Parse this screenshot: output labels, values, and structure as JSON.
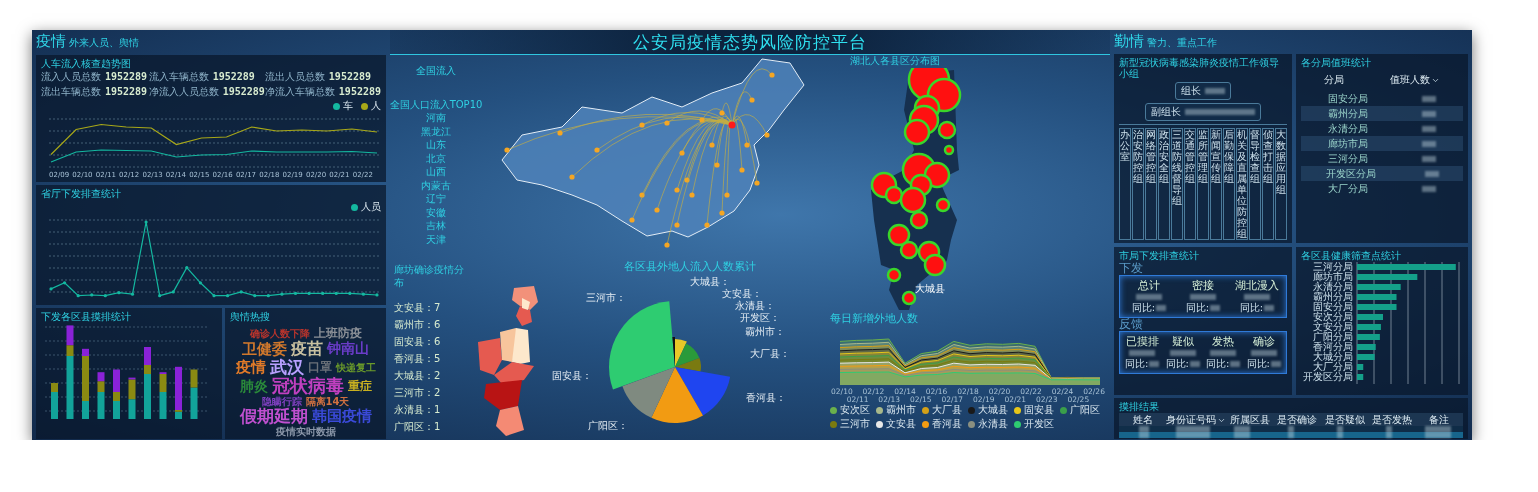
{
  "left": {
    "header": {
      "title": "疫情",
      "subtitle": "外来人员、舆情"
    },
    "flow_trend": {
      "title": "人车流入核查趋势图",
      "stats": [
        {
          "label": "流入人员总数",
          "value": "1952289"
        },
        {
          "label": "流入车辆总数",
          "value": "1952289"
        },
        {
          "label": "流出人员总数",
          "value": "1952289"
        },
        {
          "label": "流出车辆总数",
          "value": "1952289"
        },
        {
          "label": "净流入人员总数",
          "value": "1952289"
        },
        {
          "label": "净流入车辆总数",
          "value": "1952289"
        }
      ],
      "legend": [
        {
          "name": "车",
          "color": "#14b8a0"
        },
        {
          "name": "人",
          "color": "#a8a818"
        }
      ],
      "x_labels": [
        "02/09",
        "02/10",
        "02/11",
        "02/12",
        "02/13",
        "02/14",
        "02/15",
        "02/16",
        "02/17",
        "02/18",
        "02/19",
        "02/20",
        "02/21",
        "02/22"
      ]
    },
    "province_check": {
      "title": "省厅下发排查统计",
      "legend": [
        {
          "name": "人员",
          "color": "#14b8a0"
        }
      ]
    },
    "district_check": {
      "title": "下发各区县摸排统计"
    },
    "hot_search": {
      "title": "舆情热搜",
      "words": [
        {
          "text": "确诊人数下降",
          "color": "#b8342c"
        },
        {
          "text": "上班防疫",
          "color": "#8a8f96"
        },
        {
          "text": "卫健委",
          "color": "#d0782c"
        },
        {
          "text": "疫苗",
          "color": "#c8c0a0"
        },
        {
          "text": "钟南山",
          "color": "#6a3cc8"
        },
        {
          "text": "疫情",
          "color": "#e07a28"
        },
        {
          "text": "武汉",
          "color": "#b8a0ff"
        },
        {
          "text": "口罩",
          "color": "#6a7078"
        },
        {
          "text": "快递复工",
          "color": "#6a9a2a"
        },
        {
          "text": "肺炎",
          "color": "#2a8a3a"
        },
        {
          "text": "冠状病毒",
          "color": "#c040c0"
        },
        {
          "text": "重症",
          "color": "#c8b020"
        },
        {
          "text": "隐瞒行踪",
          "color": "#8040c0"
        },
        {
          "text": "隔离14天",
          "color": "#d07040"
        },
        {
          "text": "假期延期",
          "color": "#c050d0"
        },
        {
          "text": "韩国疫情",
          "color": "#3a4ad8"
        },
        {
          "text": "疫情实时数据",
          "color": "#8a96a8"
        }
      ]
    }
  },
  "center": {
    "title": "公安局疫情态势风险防控平台",
    "national_inflow": {
      "title": "全国流入",
      "top_title": "全国人口流入TOP10",
      "top": [
        "河南",
        "黑龙江",
        "山东",
        "北京",
        "山西",
        "内蒙古",
        "辽宁",
        "安徽",
        "吉林",
        "天津"
      ]
    },
    "langfang": {
      "title": "廊坊确诊疫情分布",
      "items": [
        {
          "name": "文安县：",
          "count": "7"
        },
        {
          "name": "霸州市：",
          "count": "6"
        },
        {
          "name": "固安县：",
          "count": "6"
        },
        {
          "name": "香河县：",
          "count": "5"
        },
        {
          "name": "大城县：",
          "count": "2"
        },
        {
          "name": "三河市：",
          "count": "2"
        },
        {
          "name": "永清县：",
          "count": "1"
        },
        {
          "name": "广阳区：",
          "count": "1"
        }
      ]
    },
    "pie": {
      "title": "各区县外地人流入人数累计",
      "labels": [
        "大城县：",
        "文安县：",
        "永清县：",
        "开发区：",
        "霸州市：",
        "大厂县：",
        "香河县：",
        "广阳区：",
        "固安县：",
        "三河市："
      ]
    },
    "hubei_map": {
      "title": "湖北人各县区分布图",
      "label": "大城县"
    },
    "daily_new": {
      "title": "每日新增外地人数",
      "x_labels": [
        "02/10",
        "02/11",
        "02/12",
        "02/13",
        "02/14",
        "02/15",
        "02/16",
        "02/17",
        "02/18",
        "02/19",
        "02/20",
        "02/21",
        "02/22",
        "02/23",
        "02/24",
        "02/25",
        "02/26"
      ],
      "legend": [
        {
          "name": "安次区",
          "color": "#6ab04c"
        },
        {
          "name": "霸州市",
          "color": "#a8b88a"
        },
        {
          "name": "大厂县",
          "color": "#d4a017"
        },
        {
          "name": "大城县",
          "color": "#1a1a1a"
        },
        {
          "name": "固安县",
          "color": "#e6c619"
        },
        {
          "name": "广阳区",
          "color": "#3a9e4a"
        },
        {
          "name": "三河市",
          "color": "#7a7a10"
        },
        {
          "name": "文安县",
          "color": "#e8e8e8"
        },
        {
          "name": "香河县",
          "color": "#f39c12"
        },
        {
          "name": "永清县",
          "color": "#8a8f80"
        },
        {
          "name": "开发区",
          "color": "#2ecc71"
        }
      ]
    }
  },
  "right": {
    "header": {
      "title": "勤情",
      "subtitle": "警力、重点工作"
    },
    "org": {
      "title": "新型冠状病毒感染肺炎疫情工作领导小组",
      "leader_label": "组长",
      "vice_label": "副组长",
      "groups": [
        "办公室",
        "治安防控组",
        "网络管控组",
        "政治安全组",
        "三道防线督导组",
        "交通管控组",
        "监所管理组",
        "新闻宣传组",
        "后勤保障组",
        "机关及直属单位防控组",
        "督导检查组",
        "侦查打击组",
        "大数据应用组"
      ]
    },
    "duty": {
      "title": "各分局值班统计",
      "columns": [
        "分局",
        "值班人数"
      ],
      "rows": [
        "固安分局",
        "霸州分局",
        "永清分局",
        "廊坊市局",
        "三河分局",
        "开发区分局",
        "大厂分局"
      ]
    },
    "city_check": {
      "title": "市局下发排查统计",
      "issued": {
        "label": "下发",
        "items": [
          {
            "label": "总计",
            "ratio_label": "同比:"
          },
          {
            "label": "密接",
            "ratio_label": "同比:"
          },
          {
            "label": "湖北漫入",
            "ratio_label": "同比:"
          }
        ]
      },
      "feedback": {
        "label": "反馈",
        "items": [
          {
            "label": "已摸排",
            "ratio_label": "同比:"
          },
          {
            "label": "疑似",
            "ratio_label": "同比:"
          },
          {
            "label": "发热",
            "ratio_label": "同比:"
          },
          {
            "label": "确诊",
            "ratio_label": "同比:"
          }
        ]
      }
    },
    "health_points": {
      "title": "各区县健康筛查点统计",
      "categories": [
        "三河分局",
        "廊坊市局",
        "永清分局",
        "霸州分局",
        "固安分局",
        "安次分局",
        "文安分局",
        "广阳分局",
        "香河分局",
        "大城分局",
        "大厂分局",
        "开发区分局"
      ]
    },
    "results": {
      "title": "摸排结果",
      "columns": [
        "姓名",
        "身份证号码",
        "所属区县",
        "是否确诊",
        "是否疑似",
        "是否发热",
        "备注"
      ]
    }
  }
}
